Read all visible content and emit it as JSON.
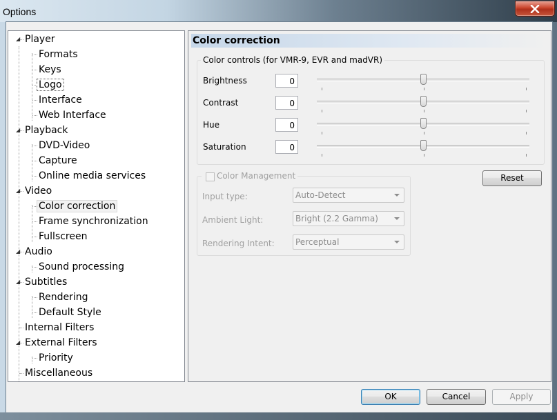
{
  "window": {
    "title": "Options",
    "close_icon": "close-icon"
  },
  "tree": {
    "items": [
      {
        "label": "Player",
        "level": 0,
        "expanded": true
      },
      {
        "label": "Formats",
        "level": 1
      },
      {
        "label": "Keys",
        "level": 1
      },
      {
        "label": "Logo",
        "level": 1
      },
      {
        "label": "Interface",
        "level": 1
      },
      {
        "label": "Web Interface",
        "level": 1
      },
      {
        "label": "Playback",
        "level": 0,
        "expanded": true
      },
      {
        "label": "DVD-Video",
        "level": 1
      },
      {
        "label": "Capture",
        "level": 1
      },
      {
        "label": "Online media services",
        "level": 1
      },
      {
        "label": "Video",
        "level": 0,
        "expanded": true
      },
      {
        "label": "Color correction",
        "level": 1,
        "selected": true
      },
      {
        "label": "Frame synchronization",
        "level": 1
      },
      {
        "label": "Fullscreen",
        "level": 1
      },
      {
        "label": "Audio",
        "level": 0,
        "expanded": true
      },
      {
        "label": "Sound processing",
        "level": 1
      },
      {
        "label": "Subtitles",
        "level": 0,
        "expanded": true
      },
      {
        "label": "Rendering",
        "level": 1
      },
      {
        "label": "Default Style",
        "level": 1
      },
      {
        "label": "Internal Filters",
        "level": 0
      },
      {
        "label": "External Filters",
        "level": 0,
        "expanded": true
      },
      {
        "label": "Priority",
        "level": 1
      },
      {
        "label": "Miscellaneous",
        "level": 0
      }
    ]
  },
  "page": {
    "title": "Color correction",
    "color_controls": {
      "legend": "Color controls (for VMR-9, EVR and madVR)",
      "brightness": {
        "label": "Brightness",
        "value": "0",
        "level": 0.5
      },
      "contrast": {
        "label": "Contrast",
        "value": "0",
        "level": 0.5
      },
      "hue": {
        "label": "Hue",
        "value": "0",
        "level": 0.5
      },
      "saturation": {
        "label": "Saturation",
        "value": "0",
        "level": 0.5
      }
    },
    "reset_label": "Reset",
    "color_management": {
      "legend": "Color Management",
      "checked": false,
      "input_type_label": "Input type:",
      "input_type_value": "Auto-Detect",
      "ambient_light_label": "Ambient Light:",
      "ambient_light_value": "Bright (2.2 Gamma)",
      "rendering_intent_label": "Rendering Intent:",
      "rendering_intent_value": "Perceptual"
    }
  },
  "buttons": {
    "ok": "OK",
    "cancel": "Cancel",
    "apply": "Apply"
  }
}
